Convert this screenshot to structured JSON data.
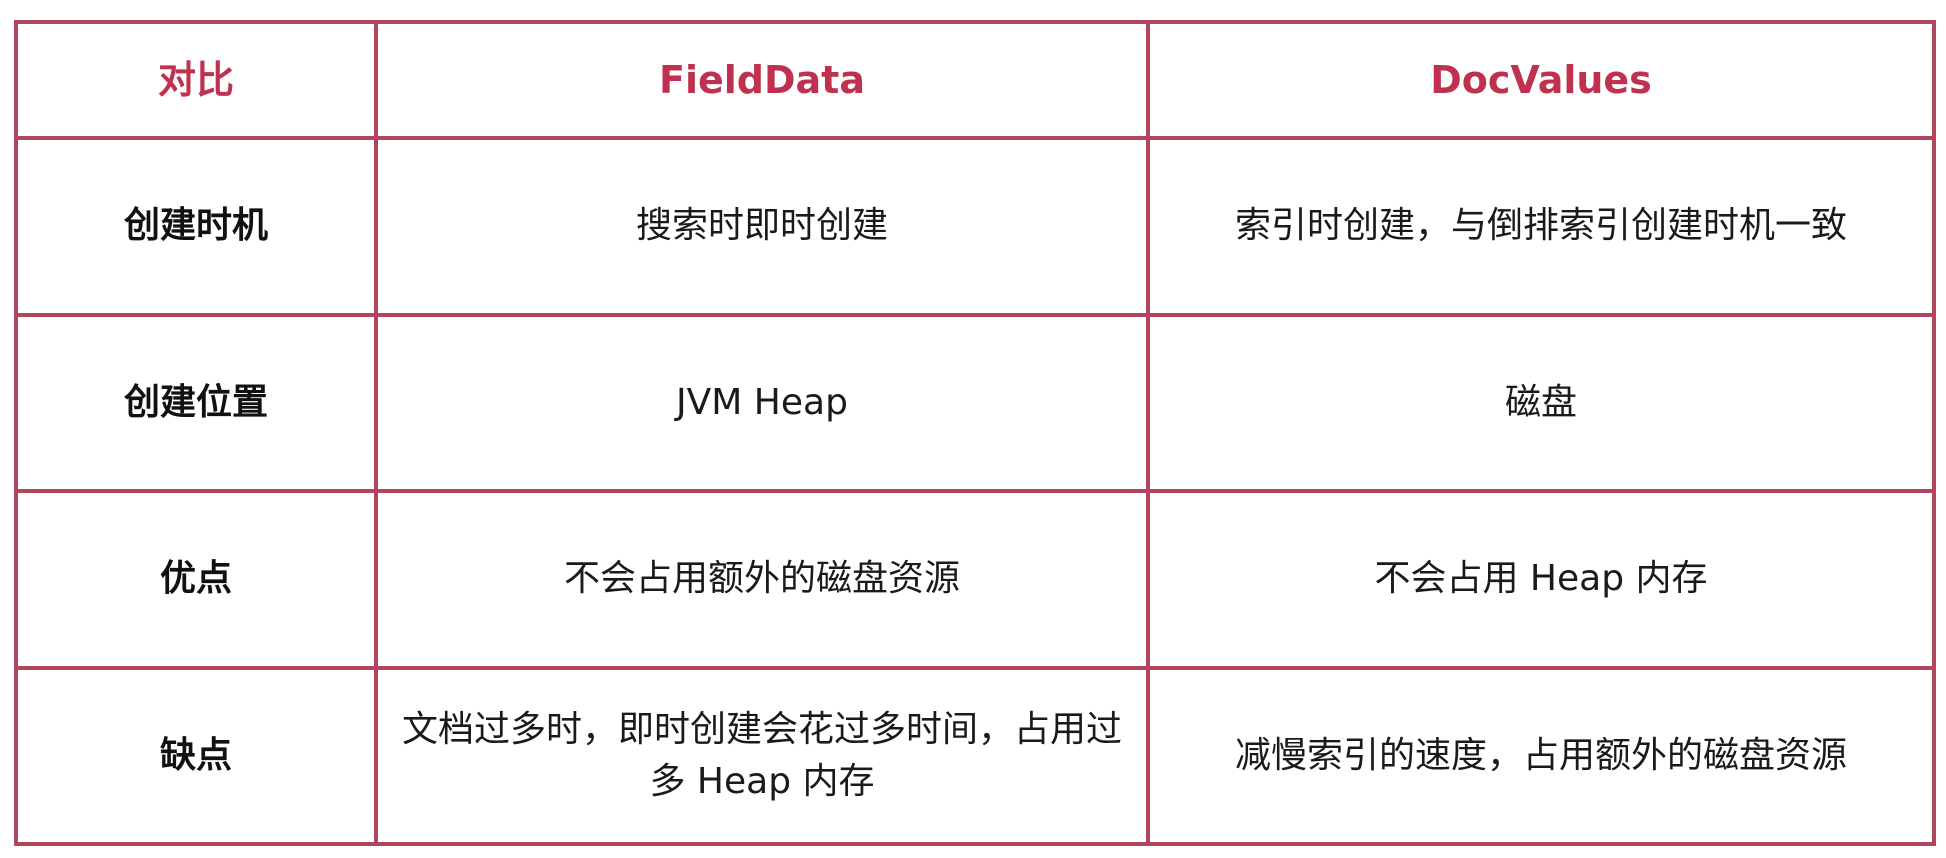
{
  "header": {
    "col0": "对比",
    "col1": "FieldData",
    "col2": "DocValues"
  },
  "rows": [
    {
      "label": "创建时机",
      "fielddata": "搜索时即时创建",
      "docvalues": "索引时创建，与倒排索引创建时机一致"
    },
    {
      "label": "创建位置",
      "fielddata": "JVM Heap",
      "docvalues": "磁盘"
    },
    {
      "label": "优点",
      "fielddata": "不会占用额外的磁盘资源",
      "docvalues": "不会占用 Heap 内存"
    },
    {
      "label": "缺点",
      "fielddata": "文档过多时，即时创建会花过多时间，占用过多 Heap 内存",
      "docvalues": "减慢索引的速度，占用额外的磁盘资源"
    }
  ],
  "colors": {
    "border": "#b0465b",
    "header_text": "#c0304f"
  }
}
